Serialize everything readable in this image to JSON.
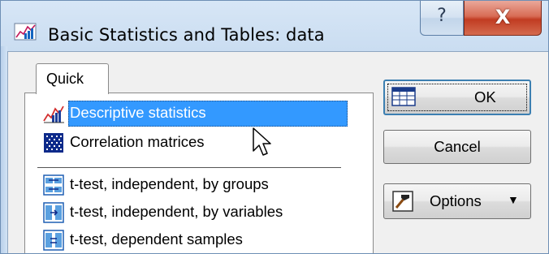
{
  "window": {
    "title": "Basic Statistics and Tables: data",
    "help_glyph": "?",
    "close_glyph": "X"
  },
  "tabs": [
    {
      "label": "Quick"
    }
  ],
  "list": {
    "items": [
      {
        "label": "Descriptive statistics",
        "icon": "descriptive-stats-icon",
        "selected": true
      },
      {
        "label": "Correlation matrices",
        "icon": "correlation-matrix-icon"
      },
      {
        "label": "t-test, independent, by groups",
        "icon": "ttest-groups-icon"
      },
      {
        "label": "t-test, independent, by variables",
        "icon": "ttest-variables-icon"
      },
      {
        "label": "t-test, dependent samples",
        "icon": "ttest-dependent-icon"
      }
    ]
  },
  "buttons": {
    "ok": "OK",
    "cancel": "Cancel",
    "options": "Options",
    "options_caret": "▼"
  },
  "colors": {
    "selection": "#3399ff",
    "close_button": "#c13c22",
    "title_bar": "#c3d8ee"
  }
}
